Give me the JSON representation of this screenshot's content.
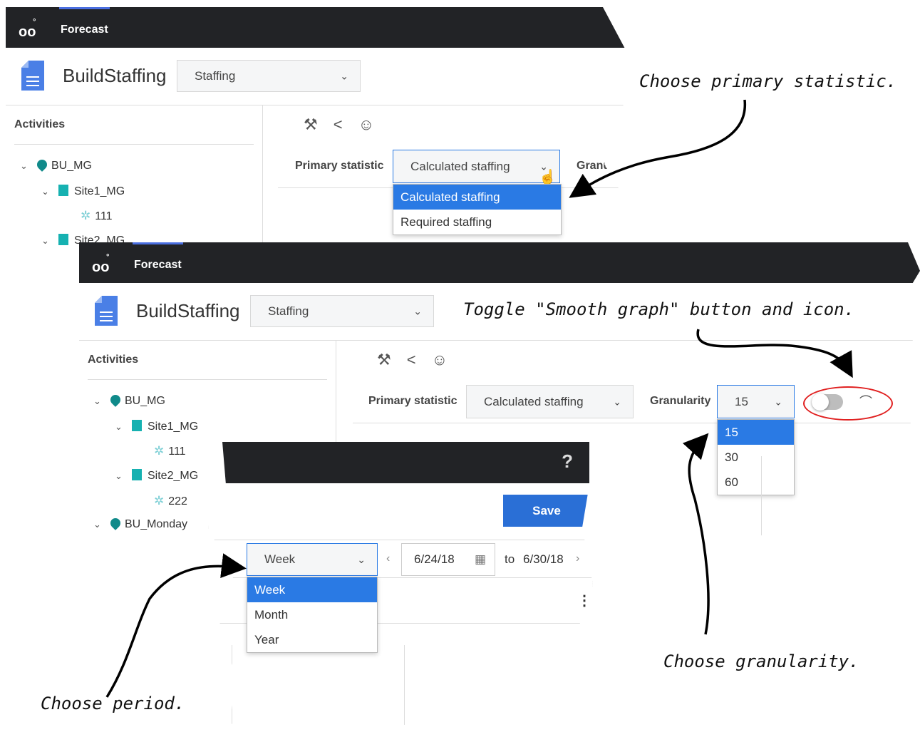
{
  "screen1": {
    "app_tab": "Forecast",
    "title": "BuildStaffing",
    "view_select": "Staffing",
    "activities_header": "Activities",
    "tree": [
      "BU_MG",
      "Site1_MG",
      "111",
      "Site2_MG"
    ],
    "primary_statistic_label": "Primary statistic",
    "primary_statistic_value": "Calculated staffing",
    "granularity_label_partial": "Granu",
    "primary_statistic_options": [
      "Calculated staffing",
      "Required staffing"
    ]
  },
  "screen2": {
    "app_tab": "Forecast",
    "title": "BuildStaffing",
    "view_select": "Staffing",
    "activities_header": "Activities",
    "tree": [
      "BU_MG",
      "Site1_MG",
      "111",
      "Site2_MG",
      "222",
      "BU_Monday"
    ],
    "primary_statistic_label": "Primary statistic",
    "primary_statistic_value": "Calculated staffing",
    "granularity_label": "Granularity",
    "granularity_value": "15",
    "granularity_options": [
      "15",
      "30",
      "60"
    ]
  },
  "screen3": {
    "help": "?",
    "save_label": "Save",
    "period_value": "Week",
    "period_options": [
      "Week",
      "Month",
      "Year"
    ],
    "start_date": "6/24/18",
    "to_label": "to",
    "end_date": "6/30/18"
  },
  "annotations": {
    "primary": "Choose primary statistic.",
    "smooth": "Toggle \"Smooth graph\" button and icon.",
    "granularity": "Choose granularity.",
    "period": "Choose period."
  },
  "colors": {
    "accent": "#2a7ae4",
    "header": "#222326",
    "teal": "#108a8a",
    "highlight_circle": "#e02020"
  },
  "icons": [
    "genesys-logo-icon",
    "document-icon",
    "chevron-down-icon",
    "location-pin-icon",
    "building-icon",
    "gear-icon",
    "wrench-icon",
    "share-icon",
    "person-settings-icon",
    "smooth-graph-icon",
    "calendar-icon",
    "chevron-left-icon",
    "chevron-right-icon",
    "more-vertical-icon",
    "pointer-hand-icon"
  ]
}
